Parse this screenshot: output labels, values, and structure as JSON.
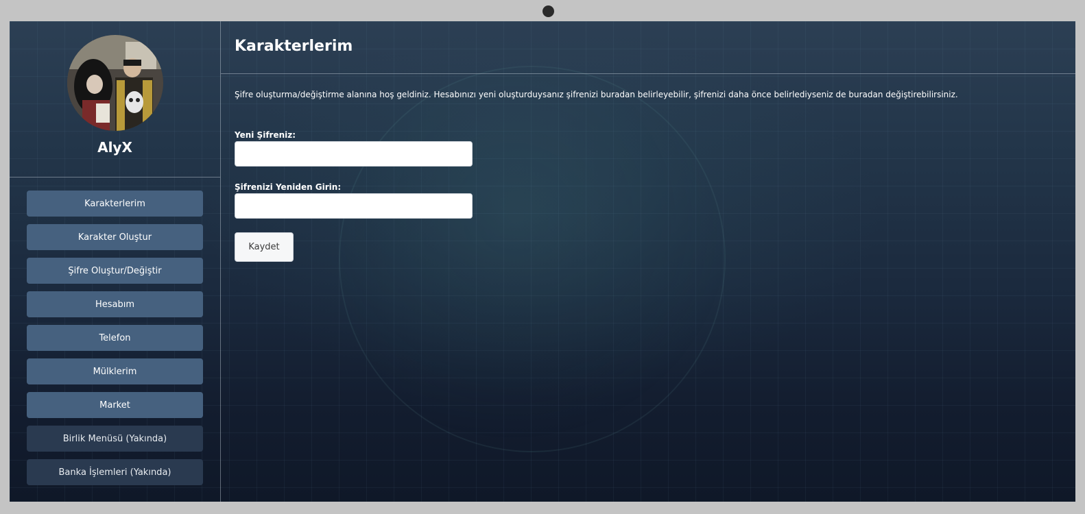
{
  "app": {
    "accent_color": "#46617f",
    "disabled_color": "#2a3a50"
  },
  "profile": {
    "username": "AlyX"
  },
  "sidebar": {
    "items": [
      {
        "label": "Karakterlerim",
        "enabled": true
      },
      {
        "label": "Karakter Oluştur",
        "enabled": true
      },
      {
        "label": "Şifre Oluştur/Değiştir",
        "enabled": true
      },
      {
        "label": "Hesabım",
        "enabled": true
      },
      {
        "label": "Telefon",
        "enabled": true
      },
      {
        "label": "Mülklerim",
        "enabled": true
      },
      {
        "label": "Market",
        "enabled": true
      },
      {
        "label": "Birlik Menüsü (Yakında)",
        "enabled": false
      },
      {
        "label": "Banka İşlemleri (Yakında)",
        "enabled": false
      }
    ]
  },
  "main": {
    "title": "Karakterlerim",
    "intro": "Şifre oluşturma/değiştirme alanına hoş geldiniz. Hesabınızı yeni oluşturduysanız şifrenizi buradan belirleyebilir, şifrenizi daha önce belirlediyseniz de buradan değiştirebilirsiniz.",
    "form": {
      "new_password_label": "Yeni Şifreniz:",
      "new_password_value": "",
      "confirm_password_label": "Şifrenizi Yeniden Girin:",
      "confirm_password_value": "",
      "save_label": "Kaydet"
    }
  }
}
